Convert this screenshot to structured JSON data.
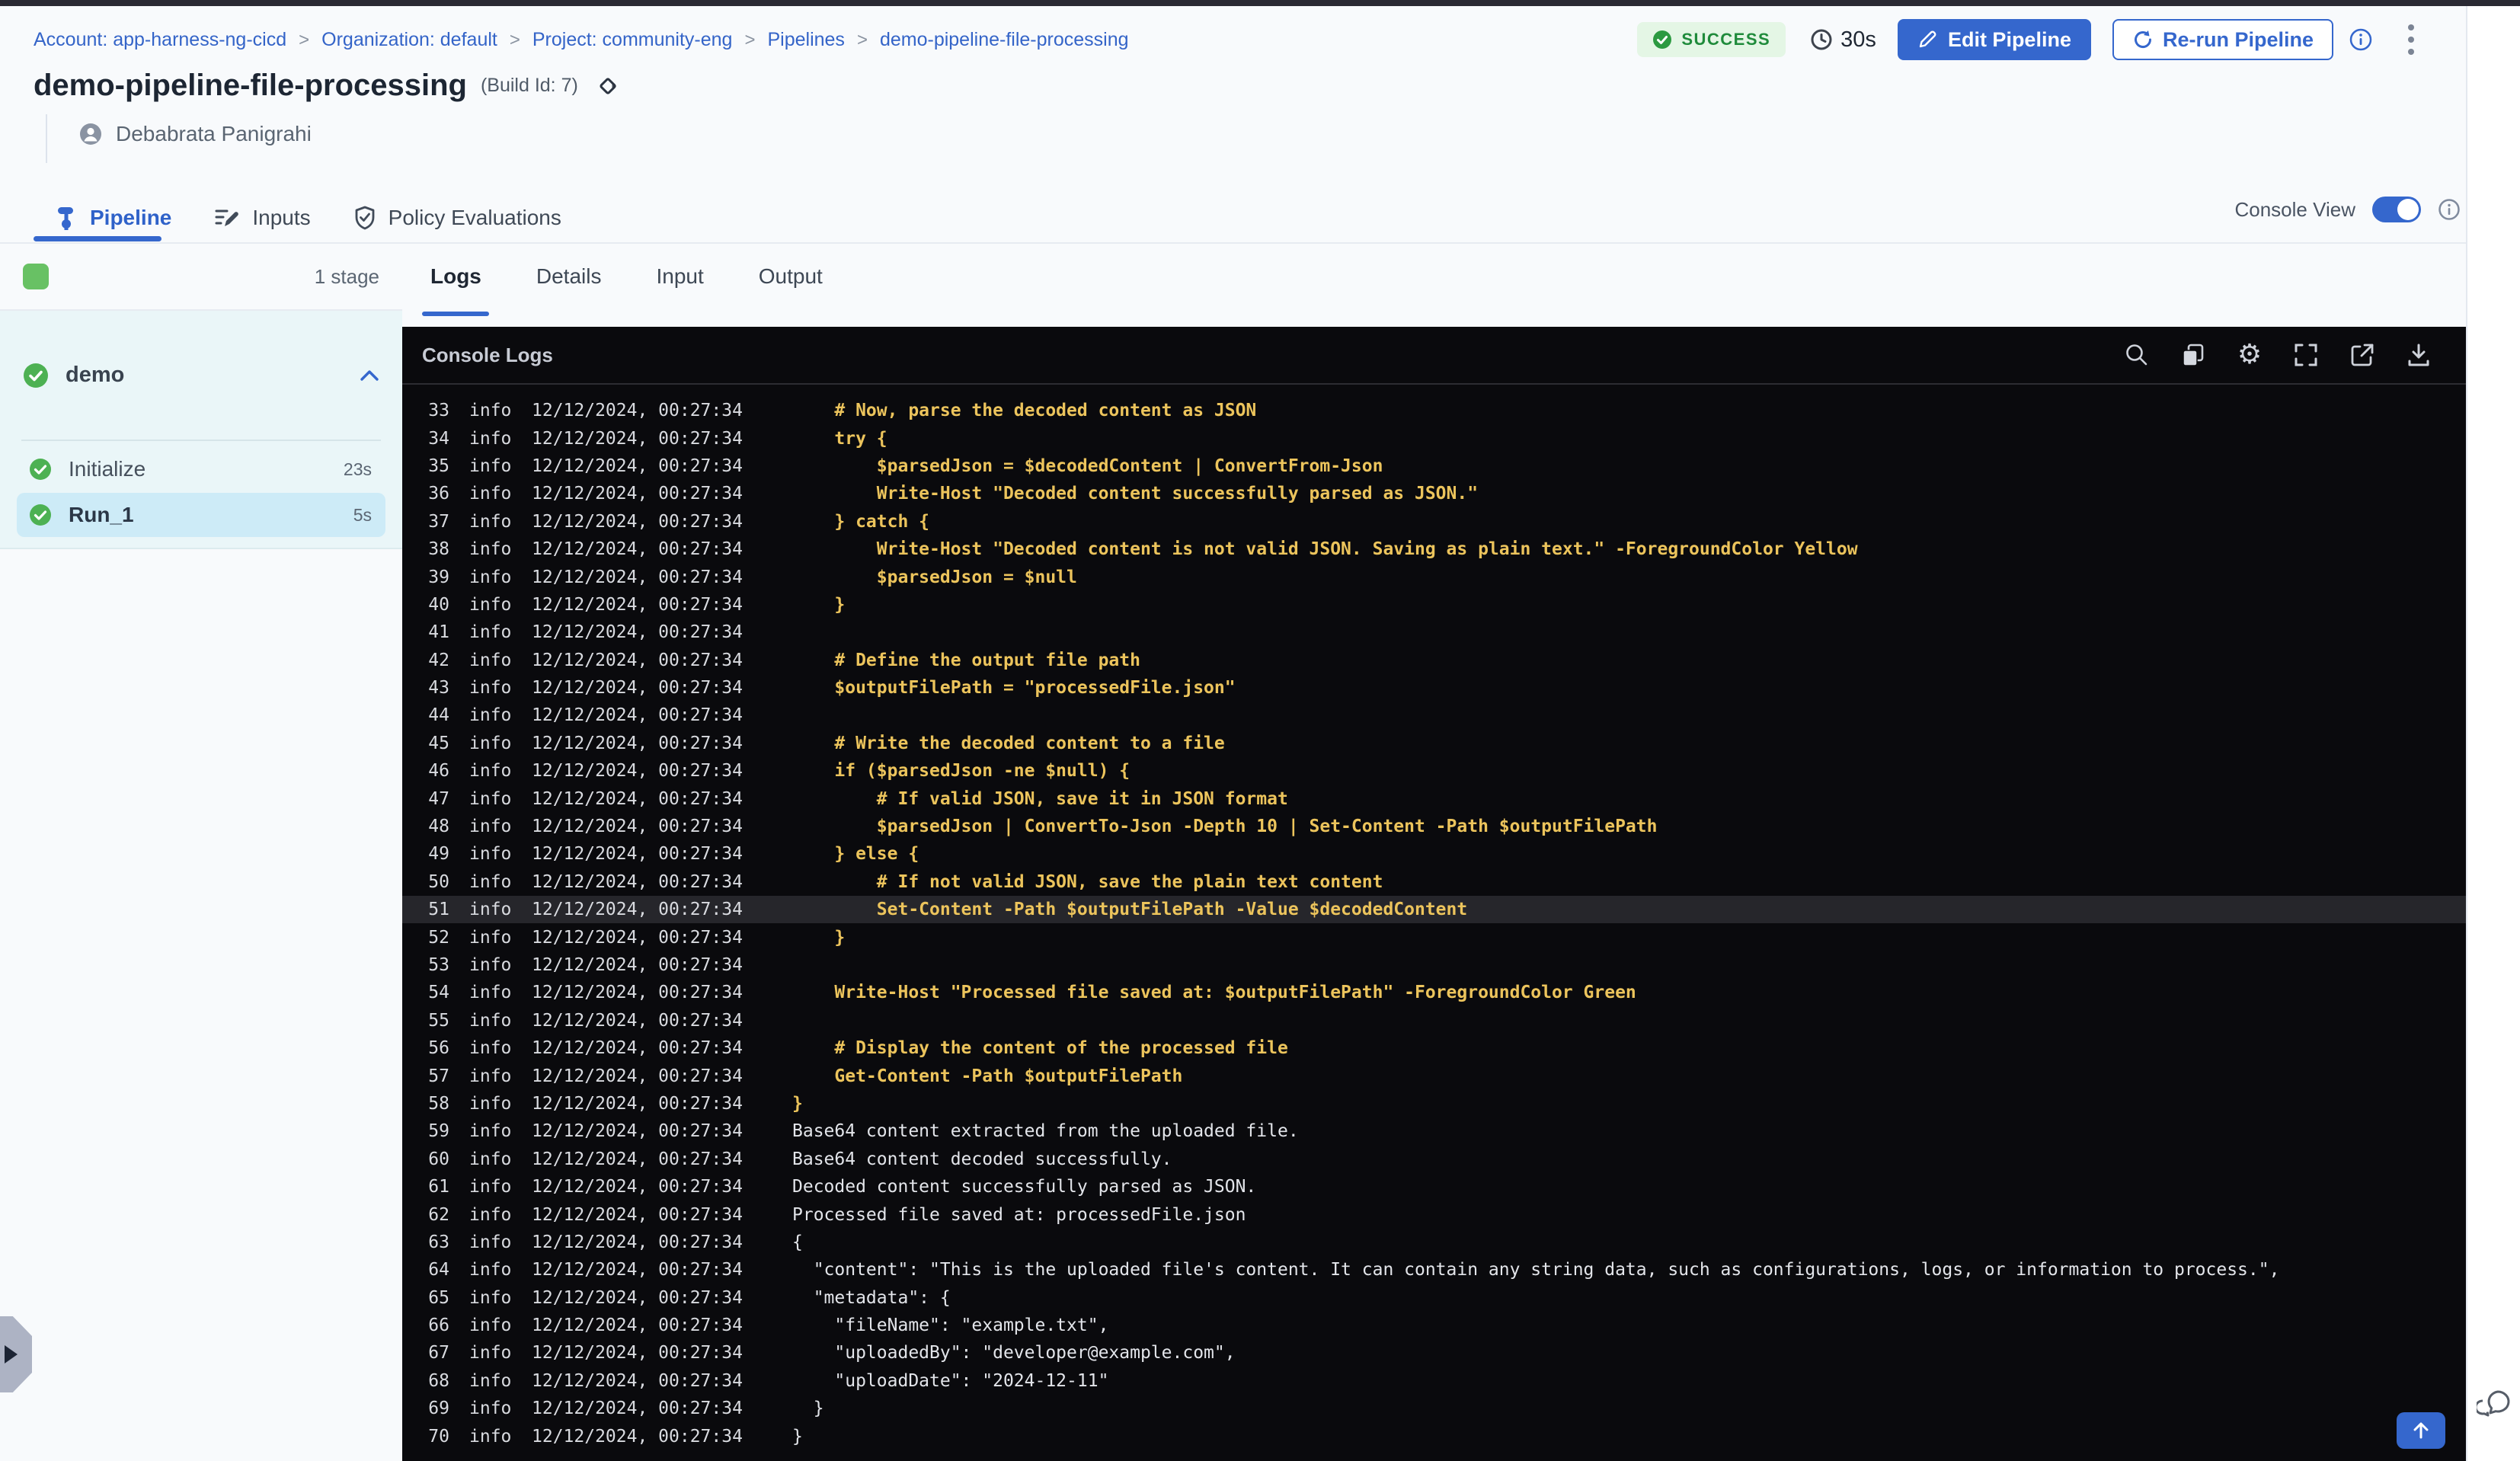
{
  "breadcrumb": {
    "separator": ">",
    "items": [
      {
        "label": "Account: app-harness-ng-cicd"
      },
      {
        "label": "Organization: default"
      },
      {
        "label": "Project: community-eng"
      },
      {
        "label": "Pipelines"
      },
      {
        "label": "demo-pipeline-file-processing"
      }
    ]
  },
  "status": {
    "label": "SUCCESS",
    "duration": "30s"
  },
  "actions": {
    "edit": "Edit Pipeline",
    "rerun": "Re-run Pipeline"
  },
  "pipeline": {
    "title": "demo-pipeline-file-processing",
    "build": "(Build Id: 7)",
    "author": "Debabrata Panigrahi"
  },
  "main_tabs": [
    {
      "label": "Pipeline",
      "active": true
    },
    {
      "label": "Inputs",
      "active": false
    },
    {
      "label": "Policy Evaluations",
      "active": false
    }
  ],
  "console_view": {
    "label": "Console View",
    "enabled": true
  },
  "stages": {
    "count_label": "1 stage",
    "name": "demo",
    "steps": [
      {
        "name": "Initialize",
        "duration": "23s",
        "selected": false
      },
      {
        "name": "Run_1",
        "duration": "5s",
        "selected": true
      }
    ]
  },
  "log_tabs": [
    "Logs",
    "Details",
    "Input",
    "Output"
  ],
  "console": {
    "title": "Console Logs",
    "toolbar_icons": [
      "search",
      "copy",
      "settings",
      "fullscreen",
      "open-in-new",
      "download"
    ]
  },
  "logs": {
    "level": "info",
    "timestamp": "12/12/2024, 00:27:34",
    "lines": [
      {
        "n": 33,
        "script": true,
        "selected": false,
        "text": "    # Now, parse the decoded content as JSON"
      },
      {
        "n": 34,
        "script": true,
        "selected": false,
        "text": "    try {"
      },
      {
        "n": 35,
        "script": true,
        "selected": false,
        "text": "        $parsedJson = $decodedContent | ConvertFrom-Json"
      },
      {
        "n": 36,
        "script": true,
        "selected": false,
        "text": "        Write-Host \"Decoded content successfully parsed as JSON.\""
      },
      {
        "n": 37,
        "script": true,
        "selected": false,
        "text": "    } catch {"
      },
      {
        "n": 38,
        "script": true,
        "selected": false,
        "text": "        Write-Host \"Decoded content is not valid JSON. Saving as plain text.\" -ForegroundColor Yellow"
      },
      {
        "n": 39,
        "script": true,
        "selected": false,
        "text": "        $parsedJson = $null"
      },
      {
        "n": 40,
        "script": true,
        "selected": false,
        "text": "    }"
      },
      {
        "n": 41,
        "script": true,
        "selected": false,
        "text": ""
      },
      {
        "n": 42,
        "script": true,
        "selected": false,
        "text": "    # Define the output file path"
      },
      {
        "n": 43,
        "script": true,
        "selected": false,
        "text": "    $outputFilePath = \"processedFile.json\""
      },
      {
        "n": 44,
        "script": true,
        "selected": false,
        "text": ""
      },
      {
        "n": 45,
        "script": true,
        "selected": false,
        "text": "    # Write the decoded content to a file"
      },
      {
        "n": 46,
        "script": true,
        "selected": false,
        "text": "    if ($parsedJson -ne $null) {"
      },
      {
        "n": 47,
        "script": true,
        "selected": false,
        "text": "        # If valid JSON, save it in JSON format"
      },
      {
        "n": 48,
        "script": true,
        "selected": false,
        "text": "        $parsedJson | ConvertTo-Json -Depth 10 | Set-Content -Path $outputFilePath"
      },
      {
        "n": 49,
        "script": true,
        "selected": false,
        "text": "    } else {"
      },
      {
        "n": 50,
        "script": true,
        "selected": false,
        "text": "        # If not valid JSON, save the plain text content"
      },
      {
        "n": 51,
        "script": true,
        "selected": true,
        "text": "        Set-Content -Path $outputFilePath -Value $decodedContent"
      },
      {
        "n": 52,
        "script": true,
        "selected": false,
        "text": "    }"
      },
      {
        "n": 53,
        "script": true,
        "selected": false,
        "text": ""
      },
      {
        "n": 54,
        "script": true,
        "selected": false,
        "text": "    Write-Host \"Processed file saved at: $outputFilePath\" -ForegroundColor Green"
      },
      {
        "n": 55,
        "script": true,
        "selected": false,
        "text": ""
      },
      {
        "n": 56,
        "script": true,
        "selected": false,
        "text": "    # Display the content of the processed file"
      },
      {
        "n": 57,
        "script": true,
        "selected": false,
        "text": "    Get-Content -Path $outputFilePath"
      },
      {
        "n": 58,
        "script": true,
        "selected": false,
        "text": "}"
      },
      {
        "n": 59,
        "script": false,
        "selected": false,
        "text": "Base64 content extracted from the uploaded file."
      },
      {
        "n": 60,
        "script": false,
        "selected": false,
        "text": "Base64 content decoded successfully."
      },
      {
        "n": 61,
        "script": false,
        "selected": false,
        "text": "Decoded content successfully parsed as JSON."
      },
      {
        "n": 62,
        "script": false,
        "selected": false,
        "text": "Processed file saved at: processedFile.json"
      },
      {
        "n": 63,
        "script": false,
        "selected": false,
        "text": "{"
      },
      {
        "n": 64,
        "script": false,
        "selected": false,
        "text": "  \"content\": \"This is the uploaded file's content. It can contain any string data, such as configurations, logs, or information to process.\","
      },
      {
        "n": 65,
        "script": false,
        "selected": false,
        "text": "  \"metadata\": {"
      },
      {
        "n": 66,
        "script": false,
        "selected": false,
        "text": "    \"fileName\": \"example.txt\","
      },
      {
        "n": 67,
        "script": false,
        "selected": false,
        "text": "    \"uploadedBy\": \"developer@example.com\","
      },
      {
        "n": 68,
        "script": false,
        "selected": false,
        "text": "    \"uploadDate\": \"2024-12-11\""
      },
      {
        "n": 69,
        "script": false,
        "selected": false,
        "text": "  }"
      },
      {
        "n": 70,
        "script": false,
        "selected": false,
        "text": "}"
      }
    ]
  },
  "colors": {
    "accent_blue": "#3567cd",
    "success_green": "#2c9a41",
    "success_bg": "#e4f6e5",
    "log_yellow": "#ecc45c",
    "console_bg": "#0a0a0d",
    "selected_step_bg": "#cdebf7",
    "stage_section_bg": "#eaf6f8"
  }
}
